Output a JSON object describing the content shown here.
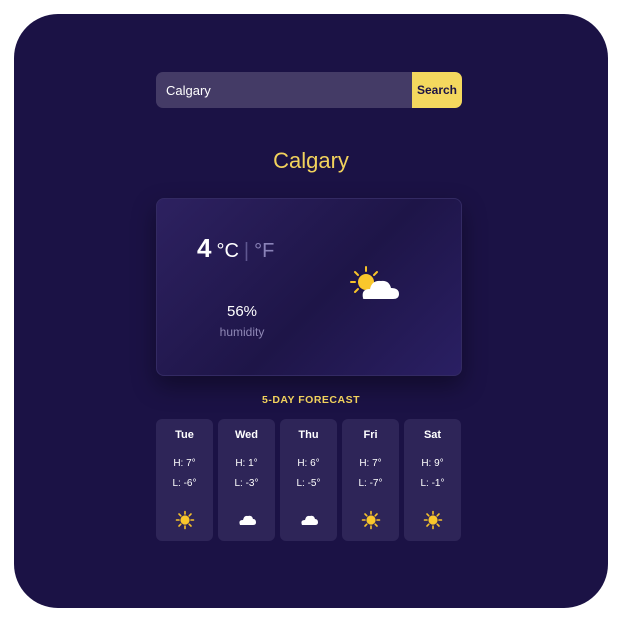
{
  "search": {
    "value": "Calgary",
    "button_label": "Search"
  },
  "location": {
    "city": "Calgary"
  },
  "current": {
    "temperature": "4",
    "unit_c": "°C",
    "unit_separator": "|",
    "unit_f": "°F",
    "active_unit": "C",
    "humidity_value": "56%",
    "humidity_label": "humidity",
    "icon": "partly-cloudy-icon"
  },
  "forecast": {
    "title": "5-DAY FORECAST",
    "days": [
      {
        "day": "Tue",
        "high": "H: 7°",
        "low": "L: -6°",
        "icon": "sun-icon"
      },
      {
        "day": "Wed",
        "high": "H: 1°",
        "low": "L: -3°",
        "icon": "cloud-icon"
      },
      {
        "day": "Thu",
        "high": "H: 6°",
        "low": "L: -5°",
        "icon": "cloud-icon"
      },
      {
        "day": "Fri",
        "high": "H: 7°",
        "low": "L: -7°",
        "icon": "sun-icon"
      },
      {
        "day": "Sat",
        "high": "H: 9°",
        "low": "L: -1°",
        "icon": "sun-icon"
      }
    ]
  },
  "colors": {
    "background": "#1b1245",
    "accent": "#f2d25c",
    "search_button": "#f4d85e",
    "card": "#2e2558"
  }
}
